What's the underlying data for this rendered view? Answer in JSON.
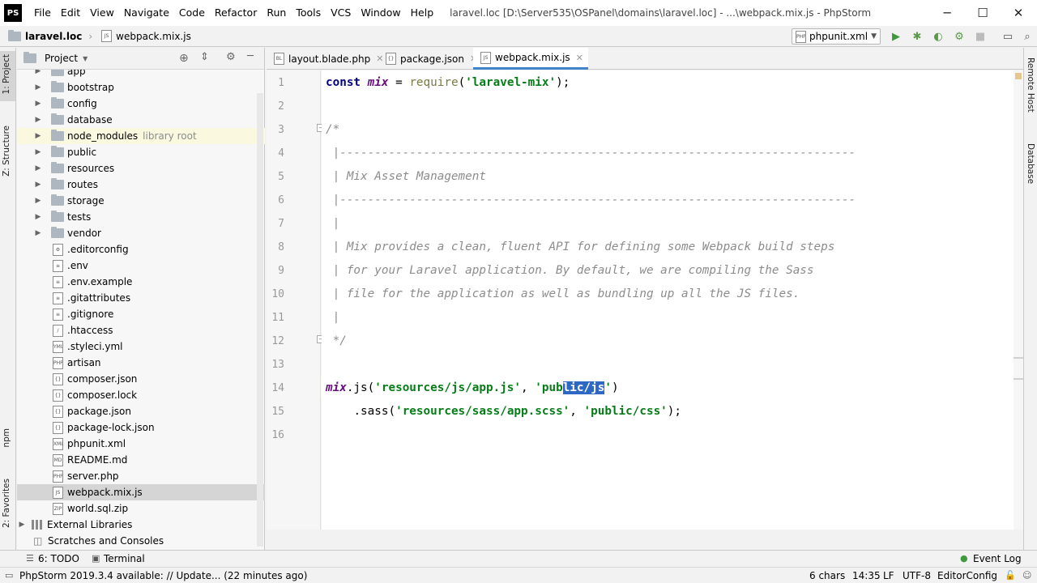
{
  "app": {
    "logo": "PS"
  },
  "menu": [
    "File",
    "Edit",
    "View",
    "Navigate",
    "Code",
    "Refactor",
    "Run",
    "Tools",
    "VCS",
    "Window",
    "Help"
  ],
  "window_title": "laravel.loc [D:\\Server535\\OSPanel\\domains\\laravel.loc] - ...\\webpack.mix.js - PhpStorm",
  "breadcrumbs": [
    "laravel.loc",
    "webpack.mix.js"
  ],
  "run_config": "phpunit.xml",
  "left_tabs": [
    "1: Project",
    "Z: Structure",
    "npm",
    "2: Favorites"
  ],
  "right_tabs": [
    "Remote Host",
    "Database"
  ],
  "project_panel": {
    "title": "Project"
  },
  "tree": [
    {
      "label": "app",
      "type": "folder"
    },
    {
      "label": "bootstrap",
      "type": "folder"
    },
    {
      "label": "config",
      "type": "folder"
    },
    {
      "label": "database",
      "type": "folder"
    },
    {
      "label": "node_modules",
      "type": "folder",
      "tag": "library root"
    },
    {
      "label": "public",
      "type": "folder"
    },
    {
      "label": "resources",
      "type": "folder"
    },
    {
      "label": "routes",
      "type": "folder"
    },
    {
      "label": "storage",
      "type": "folder"
    },
    {
      "label": "tests",
      "type": "folder"
    },
    {
      "label": "vendor",
      "type": "folder"
    },
    {
      "label": ".editorconfig",
      "type": "file",
      "icon": "⚙"
    },
    {
      "label": ".env",
      "type": "file",
      "icon": "≡"
    },
    {
      "label": ".env.example",
      "type": "file",
      "icon": "≡"
    },
    {
      "label": ".gitattributes",
      "type": "file",
      "icon": "≡"
    },
    {
      "label": ".gitignore",
      "type": "file",
      "icon": "≡"
    },
    {
      "label": ".htaccess",
      "type": "file",
      "icon": "/"
    },
    {
      "label": ".styleci.yml",
      "type": "file",
      "icon": "YML"
    },
    {
      "label": "artisan",
      "type": "file",
      "icon": "PHP"
    },
    {
      "label": "composer.json",
      "type": "file",
      "icon": "{}"
    },
    {
      "label": "composer.lock",
      "type": "file",
      "icon": "{}"
    },
    {
      "label": "package.json",
      "type": "file",
      "icon": "{}"
    },
    {
      "label": "package-lock.json",
      "type": "file",
      "icon": "{}"
    },
    {
      "label": "phpunit.xml",
      "type": "file",
      "icon": "XML"
    },
    {
      "label": "README.md",
      "type": "file",
      "icon": "MD"
    },
    {
      "label": "server.php",
      "type": "file",
      "icon": "PHP"
    },
    {
      "label": "webpack.mix.js",
      "type": "file",
      "icon": "JS",
      "selected": true
    },
    {
      "label": "world.sql.zip",
      "type": "file",
      "icon": "ZIP"
    },
    {
      "label": "External Libraries",
      "type": "lib"
    },
    {
      "label": "Scratches and Consoles",
      "type": "scratch"
    }
  ],
  "editor_tabs": [
    {
      "label": "layout.blade.php",
      "icon": "BL"
    },
    {
      "label": "package.json",
      "icon": "{}"
    },
    {
      "label": "webpack.mix.js",
      "icon": "JS",
      "active": true
    }
  ],
  "code_lines": [
    "1",
    "2",
    "3",
    "4",
    "5",
    "6",
    "7",
    "8",
    "9",
    "10",
    "11",
    "12",
    "13",
    "14",
    "15",
    "16"
  ],
  "code": {
    "l1_kw": "const",
    "l1_var": "mix",
    "l1_eq": " = ",
    "l1_fn": "require",
    "l1_open": "(",
    "l1_str": "'laravel-mix'",
    "l1_end": ");",
    "l3": "/*",
    "l4": " |--------------------------------------------------------------------------",
    "l5": " | Mix Asset Management",
    "l6": " |--------------------------------------------------------------------------",
    "l7": " |",
    "l8": " | Mix provides a clean, fluent API for defining some Webpack build steps",
    "l9": " | for your Laravel application. By default, we are compiling the Sass",
    "l10": " | file for the application as well as bundling up all the JS files.",
    "l11": " |",
    "l12": " */",
    "l14_var": "mix",
    "l14_call": ".js(",
    "l14_str1": "'resources/js/app.js'",
    "l14_sep": ", ",
    "l14_str2a": "'pub",
    "l14_sel": "lic/js",
    "l14_str2b": "'",
    "l14_end": ")",
    "l15_indent": "    ",
    "l15_call": ".sass(",
    "l15_str1": "'resources/sass/app.scss'",
    "l15_sep": ", ",
    "l15_str2": "'public/css'",
    "l15_end": ");"
  },
  "bottom_tabs": {
    "todo": "6: TODO",
    "terminal": "Terminal",
    "event_log": "Event Log"
  },
  "status": {
    "message": "PhpStorm 2019.3.4 available: // Update... (22 minutes ago)",
    "chars": "6 chars",
    "position": "14:35",
    "line_sep": "LF",
    "encoding": "UTF-8",
    "editorconfig": "EditorConfig"
  }
}
